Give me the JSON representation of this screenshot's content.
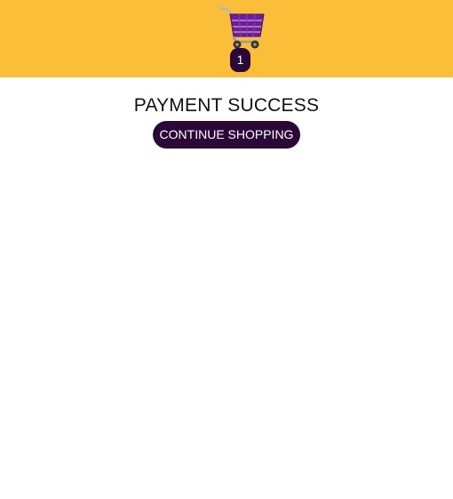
{
  "header": {
    "cart_icon": "shopping-cart-icon",
    "cart_count": "1",
    "colors": {
      "background": "#fbbe38",
      "badge": "#2a0838",
      "cart_basket": "#6a1bb0"
    }
  },
  "main": {
    "title": "PAYMENT SUCCESS",
    "continue_label": "CONTINUE SHOPPING",
    "colors": {
      "button": "#2a0838",
      "button_text": "#ffffff"
    }
  }
}
